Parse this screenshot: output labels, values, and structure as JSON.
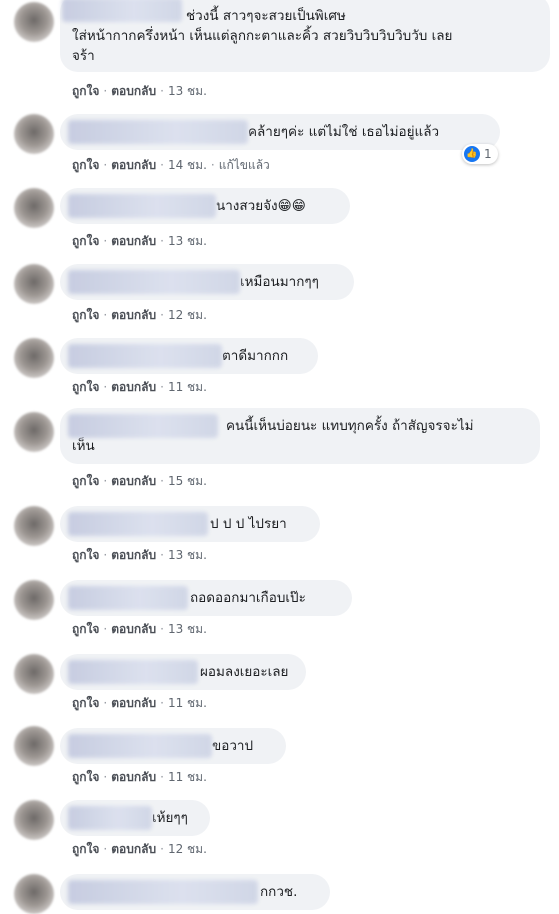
{
  "actions": {
    "like": "ถูกใจ",
    "reply": "ตอบกลับ",
    "edited": "แก้ไขแล้ว"
  },
  "comments": [
    {
      "line1": "ช่วงนี้ สาวๆจะสวยเป็นพิเศษ",
      "line2": "ใส่หน้ากากครึ่งหน้า เห็นแต่ลูกกะตาและคิ้ว สวยวิบวิบวิบวิบวับ เลย",
      "line3": "จร้า",
      "time": "13 ชม."
    },
    {
      "text": "คล้ายๆค่ะ แต่ไม่ใช่ เธอไม่อยู่แล้ว",
      "time": "14 ชม.",
      "reaction_count": "1"
    },
    {
      "text": "นางสวยจัง😁😁",
      "time": "13 ชม."
    },
    {
      "text": "เหมือนมากๆๆ",
      "time": "12 ชม."
    },
    {
      "text": "ตาดีมากกก",
      "time": "11 ชม."
    },
    {
      "line1": "คนนี้เห็นบ่อยนะ แทบทุกครั้ง ถ้าสัญจรจะไม่",
      "line2": "เห็น",
      "time": "15 ชม."
    },
    {
      "text": "ป ป ป ไปรยา",
      "time": "13 ชม."
    },
    {
      "text": "ถอดออกมาเกือบเป๊ะ",
      "time": "13 ชม."
    },
    {
      "text": "ผอมลงเยอะเลย",
      "time": "11 ชม."
    },
    {
      "text": "ขอวาป",
      "time": "11 ชม."
    },
    {
      "text": "เห้ยๆๆ",
      "time": "12 ชม."
    },
    {
      "text": "กกวช.",
      "time": ""
    }
  ],
  "icons": {
    "reaction": "like-icon"
  },
  "colors": {
    "bubble": "#f0f2f5",
    "like": "#1877f2",
    "meta": "#606770"
  }
}
